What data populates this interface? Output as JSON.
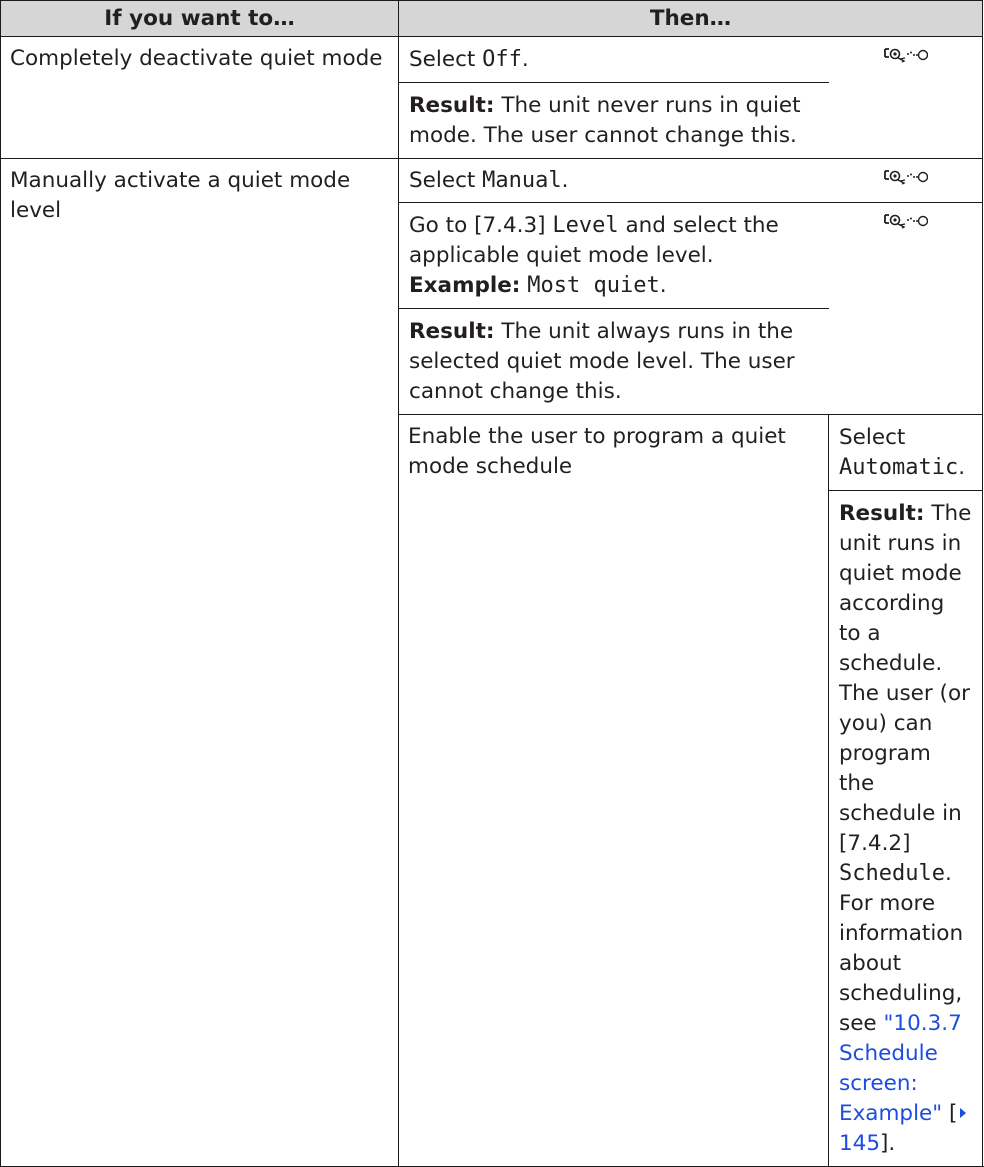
{
  "header": {
    "col1": "If you want to…",
    "col2": "Then…"
  },
  "rows": [
    {
      "action": "Completely deactivate quiet mode",
      "select_prefix": "Select ",
      "select_value": "Off",
      "select_suffix": ".",
      "result_label": "Result:",
      "result_text": " The unit never runs in quiet mode. The user cannot change this."
    },
    {
      "action": "Manually activate a quiet mode level",
      "select_prefix": "Select ",
      "select_value": "Manual",
      "select_suffix": ".",
      "goto_prefix": "Go to [7.4.3] ",
      "goto_value": "Level",
      "goto_suffix": " and select the applicable quiet mode level.",
      "example_label": "Example:",
      "example_value": "Most quiet",
      "example_suffix": ".",
      "result_label": "Result:",
      "result_text": " The unit always runs in the selected quiet mode level. The user cannot change this."
    },
    {
      "action": "Enable the user to program a quiet mode schedule",
      "select_prefix": "Select ",
      "select_value": "Automatic",
      "select_suffix": ".",
      "result_label": "Result:",
      "result_text_1": " The unit runs in quiet mode according to a schedule. The user (or you) can program the schedule in [7.4.2] ",
      "result_value": "Schedule",
      "result_text_2": ". For more information about scheduling, see ",
      "link_text": "\"10.3.7 Schedule screen: Example\"",
      "page_ref_open": " [",
      "page_ref": "145",
      "page_ref_close": "]."
    }
  ],
  "icons": {
    "user_access": "user-access-level-icon"
  },
  "colors": {
    "header_bg": "#d6d6d6",
    "link": "#1d4de0"
  }
}
